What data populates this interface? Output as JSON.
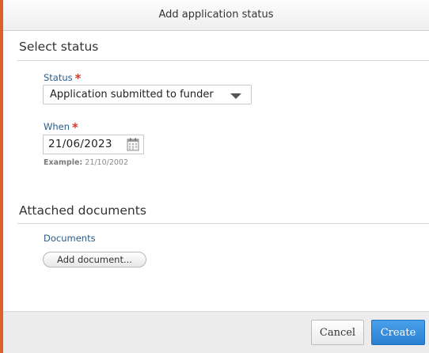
{
  "dialog": {
    "title": "Add application status",
    "accent_color": "#d9622b"
  },
  "select_status": {
    "heading": "Select status",
    "status_label": "Status",
    "status_value": "Application submitted to funder",
    "when_label": "When",
    "when_value": "21/06/2023",
    "hint_prefix": "Example:",
    "hint_value": "21/10/2002",
    "required_marker": "*"
  },
  "attached_documents": {
    "heading": "Attached documents",
    "documents_label": "Documents",
    "add_document_label": "Add document..."
  },
  "footer": {
    "cancel_label": "Cancel",
    "create_label": "Create",
    "primary_color": "#2a7fd0"
  },
  "icons": {
    "calendar": "calendar-icon",
    "dropdown": "chevron-down-icon"
  }
}
